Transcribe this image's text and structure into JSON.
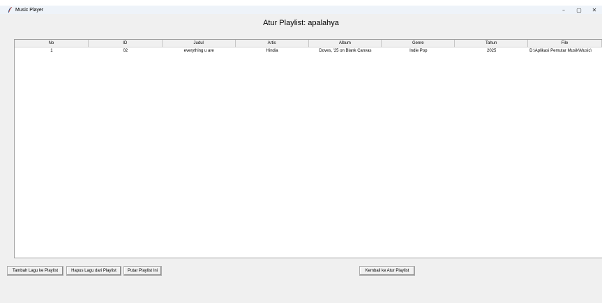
{
  "window": {
    "title": "Music Player",
    "controls": {
      "minimize": "–",
      "maximize": "▢",
      "close": "✕"
    }
  },
  "heading": "Atur Playlist: apalahya",
  "table": {
    "columns": [
      "No",
      "ID",
      "Judul",
      "Artis",
      "Album",
      "Genre",
      "Tahun",
      "File"
    ],
    "rows": [
      [
        "1",
        "02",
        "everything u are",
        "Hindia",
        "Doves, '25 on Blank Canvas",
        "Indie Pop",
        "2025",
        "D:\\Aplikasi Pemutar Musik\\Music\\"
      ]
    ]
  },
  "buttons": {
    "add": "Tambah Lagu ke Playlist",
    "remove": "Hapus Lagu dari Playlist",
    "play": "Putar Playlist Ini",
    "back": "Kembali ke Atur Playlist"
  }
}
